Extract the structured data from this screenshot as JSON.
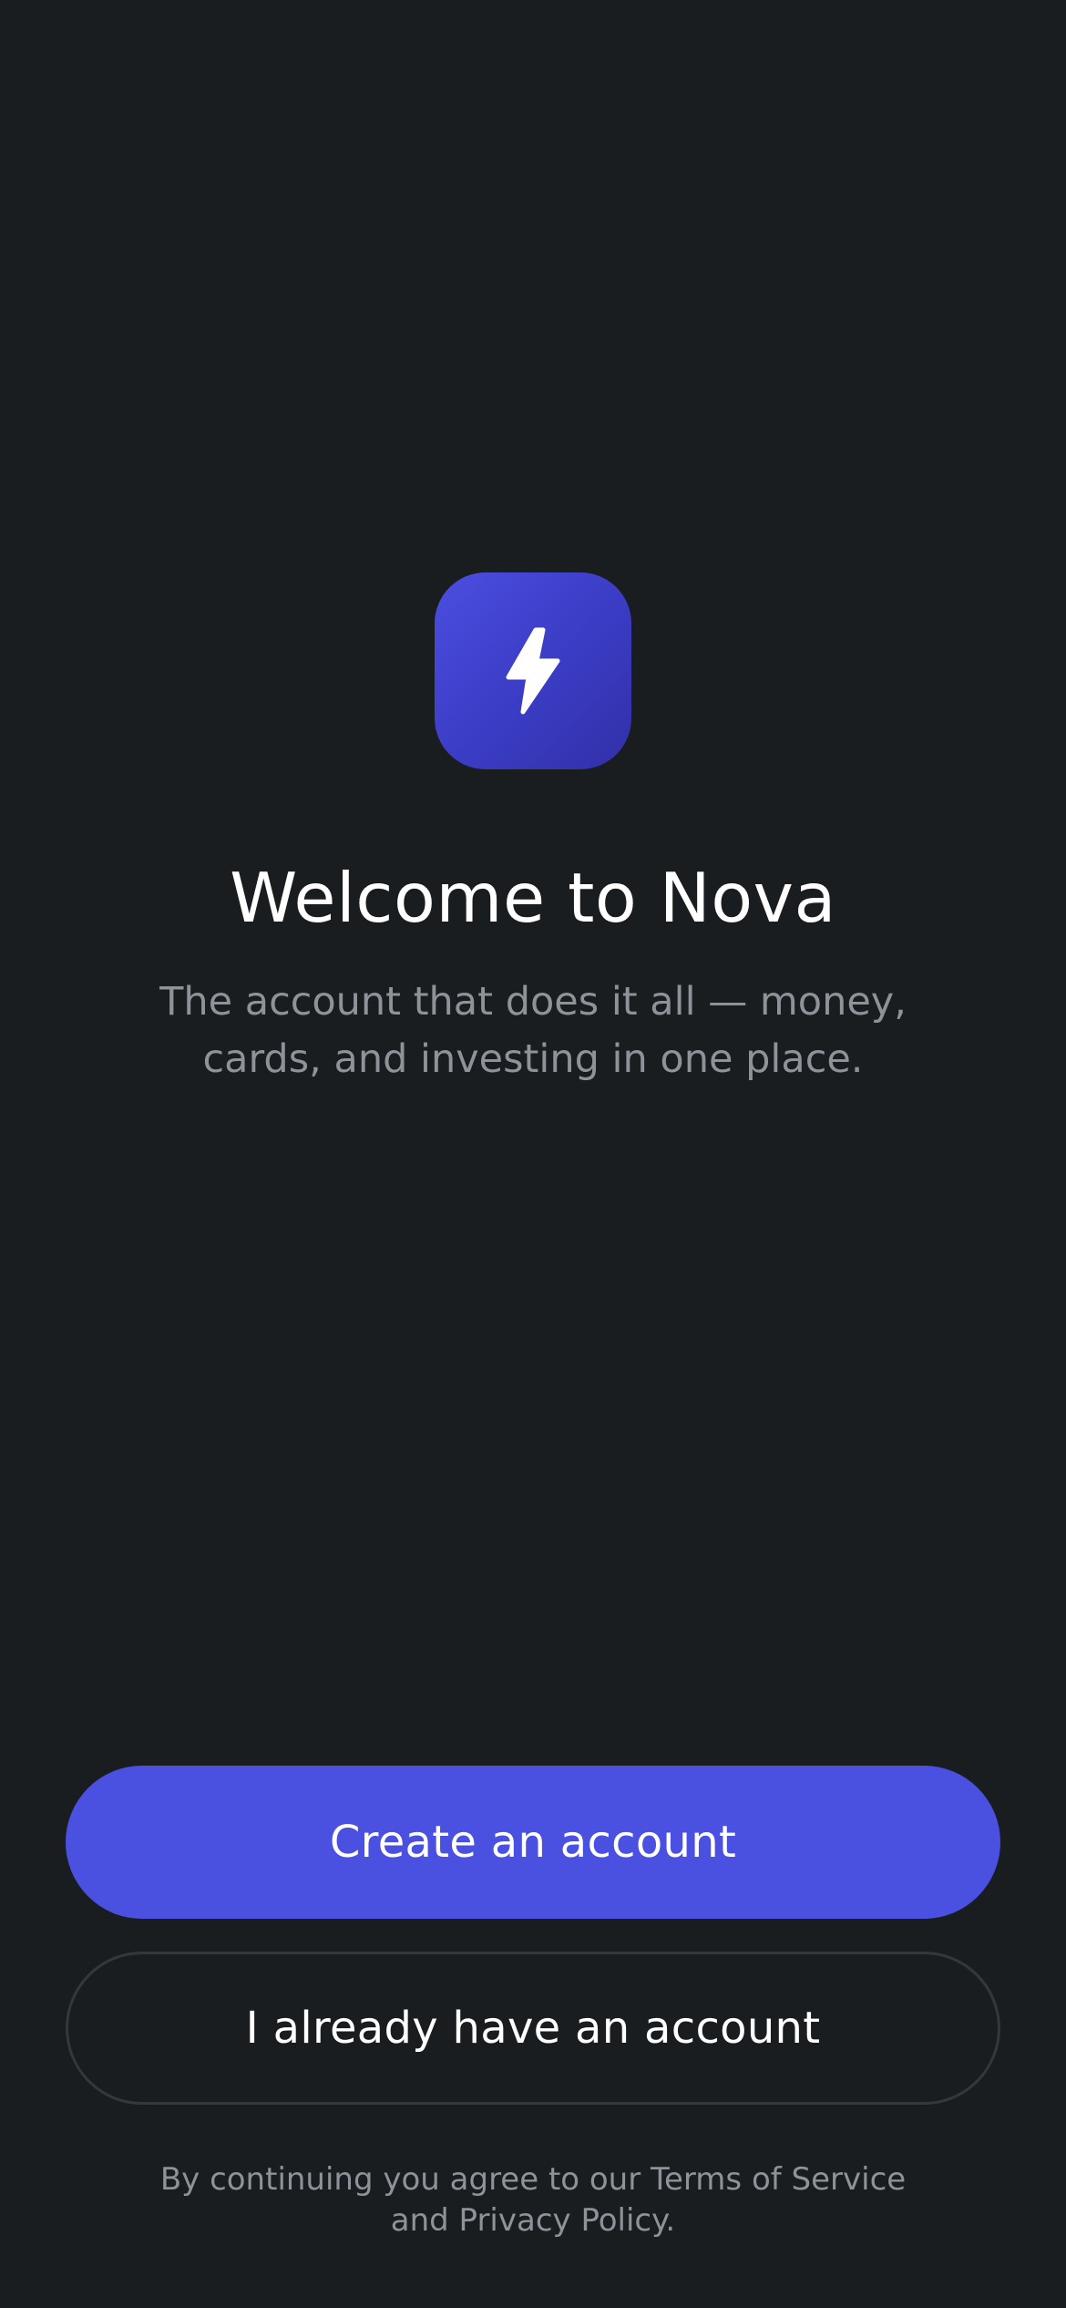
{
  "app": {
    "icon": "lightning-bolt-icon",
    "colors": {
      "background": "#1a1d20",
      "accent": "#4a50df",
      "muted_text": "#8e939a",
      "outline": "#34383d"
    }
  },
  "welcome": {
    "title": "Welcome to Nova",
    "subtitle_line1": "The account that does it all — money,",
    "subtitle_line2": "cards, and investing in one place."
  },
  "actions": {
    "create_label": "Create an account",
    "signin_label": "I already have an account"
  },
  "legal": {
    "line1": "By continuing you agree to our Terms of Service",
    "line2": "and Privacy Policy."
  }
}
